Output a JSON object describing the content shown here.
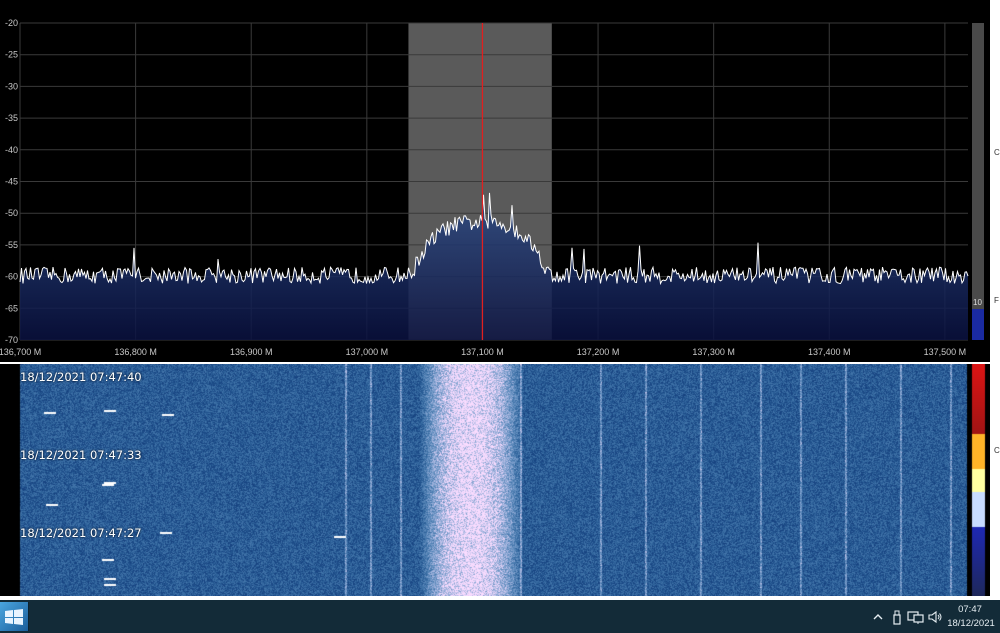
{
  "spectrum": {
    "db_labels": [
      "-20",
      "-25",
      "-30",
      "-35",
      "-40",
      "-45",
      "-50",
      "-55",
      "-60",
      "-65",
      "-70"
    ],
    "db_range": [
      -70,
      -20
    ],
    "freq_labels": [
      "136,700 M",
      "136,800 M",
      "136,900 M",
      "137,000 M",
      "137,100 M",
      "137,200 M",
      "137,300 M",
      "137,400 M",
      "137,500 M"
    ],
    "freq_range_mhz": [
      136.7,
      137.52
    ],
    "center_freq_mhz": 137.1,
    "filter_band_mhz": [
      137.036,
      137.16
    ],
    "noise_floor_db": -59.8,
    "signal_peak_db": -51.5,
    "gain_bar_value": "10",
    "colors": {
      "background": "#000000",
      "grid": "#3a3a3a",
      "trace": "#ffffff",
      "fill_top": "#2b4a86",
      "fill_bottom": "#0a1140",
      "filter_band": "#5a5a5a",
      "center_line": "#e02020",
      "axis_text": "#c8c8c8"
    }
  },
  "waterfall": {
    "timestamps": [
      "18/12/2021 07:47:40",
      "18/12/2021 07:47:33",
      "18/12/2021 07:47:27"
    ],
    "signal_band_mhz": [
      137.045,
      137.135
    ]
  },
  "right_strip": {
    "letters": [
      "C",
      "F",
      "C"
    ]
  },
  "taskbar": {
    "time": "07:47",
    "date": "18/12/2021",
    "tray_icons": [
      "chevron-up-icon",
      "usb-drive-icon",
      "network-icon",
      "speaker-icon"
    ]
  }
}
